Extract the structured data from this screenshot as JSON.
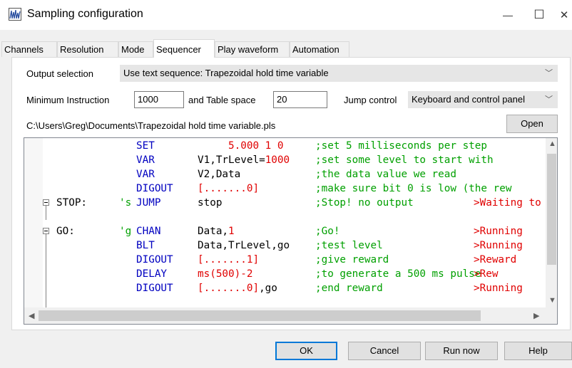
{
  "window": {
    "title": "Sampling configuration",
    "min_glyph": "—",
    "max_glyph": "☐",
    "close_glyph": "✕"
  },
  "tabs": [
    "Channels",
    "Resolution",
    "Mode",
    "Sequencer",
    "Play waveform",
    "Automation"
  ],
  "active_tab": "Sequencer",
  "output_selection": {
    "label": "Output selection",
    "value": "Use text sequence: Trapezoidal hold time variable"
  },
  "min_instruction": {
    "label": "Minimum Instruction",
    "value": "1000"
  },
  "table_space": {
    "label": "and Table space",
    "value": "20"
  },
  "jump_control": {
    "label": "Jump control",
    "value": "Keyboard and control panel"
  },
  "file_path": "C:\\Users\\Greg\\Documents\\Trapezoidal hold time variable.pls",
  "open_button": "Open",
  "code_lines": [
    {
      "label": "",
      "key": "",
      "cmd": "SET",
      "args": [
        {
          "t": "     5.000 1 0",
          "c": "red"
        }
      ],
      "comment": ";set 5 milliseconds per step",
      "marker": "",
      "fold": false
    },
    {
      "label": "",
      "key": "",
      "cmd": "VAR",
      "args": [
        {
          "t": "V1,TrLevel=",
          "c": "black"
        },
        {
          "t": "1000",
          "c": "red"
        }
      ],
      "comment": ";set some level to start with",
      "marker": "",
      "fold": false
    },
    {
      "label": "",
      "key": "",
      "cmd": "VAR",
      "args": [
        {
          "t": "V2,Data",
          "c": "black"
        }
      ],
      "comment": ";the data value we read",
      "marker": "",
      "fold": false
    },
    {
      "label": "",
      "key": "",
      "cmd": "DIGOUT",
      "args": [
        {
          "t": "[.......0]",
          "c": "red"
        }
      ],
      "comment": ";make sure bit 0 is low (the rew",
      "marker": "",
      "fold": false
    },
    {
      "label": "STOP:",
      "key": "'s",
      "cmd": "JUMP",
      "args": [
        {
          "t": "stop",
          "c": "black"
        }
      ],
      "comment": ";Stop! no output",
      "marker": ">Waiting to",
      "fold": true
    },
    {
      "label": "",
      "key": "",
      "cmd": "",
      "args": [],
      "comment": "",
      "marker": "",
      "fold": false
    },
    {
      "label": "GO:",
      "key": "'g",
      "cmd": "CHAN",
      "args": [
        {
          "t": "Data,",
          "c": "black"
        },
        {
          "t": "1",
          "c": "red"
        }
      ],
      "comment": ";Go!",
      "marker": ">Running",
      "fold": true
    },
    {
      "label": "",
      "key": "",
      "cmd": "BLT",
      "args": [
        {
          "t": "Data,TrLevel,go",
          "c": "black"
        }
      ],
      "comment": ";test level",
      "marker": ">Running",
      "fold": false
    },
    {
      "label": "",
      "key": "",
      "cmd": "DIGOUT",
      "args": [
        {
          "t": "[.......1]",
          "c": "red"
        }
      ],
      "comment": ";give reward",
      "marker": ">Reward",
      "fold": false
    },
    {
      "label": "",
      "key": "",
      "cmd": "DELAY",
      "args": [
        {
          "t": "ms(",
          "c": "red"
        },
        {
          "t": "500",
          "c": "red"
        },
        {
          "t": ")-2",
          "c": "red"
        }
      ],
      "comment": ";to generate a 500 ms pulse",
      "marker": ">Rew",
      "fold": false
    },
    {
      "label": "",
      "key": "",
      "cmd": "DIGOUT",
      "args": [
        {
          "t": "[.......0]",
          "c": "red"
        },
        {
          "t": ",go",
          "c": "black"
        }
      ],
      "comment": ";end reward",
      "marker": ">Running",
      "fold": false
    }
  ],
  "buttons": {
    "ok": "OK",
    "cancel": "Cancel",
    "run_now": "Run now",
    "help": "Help"
  }
}
